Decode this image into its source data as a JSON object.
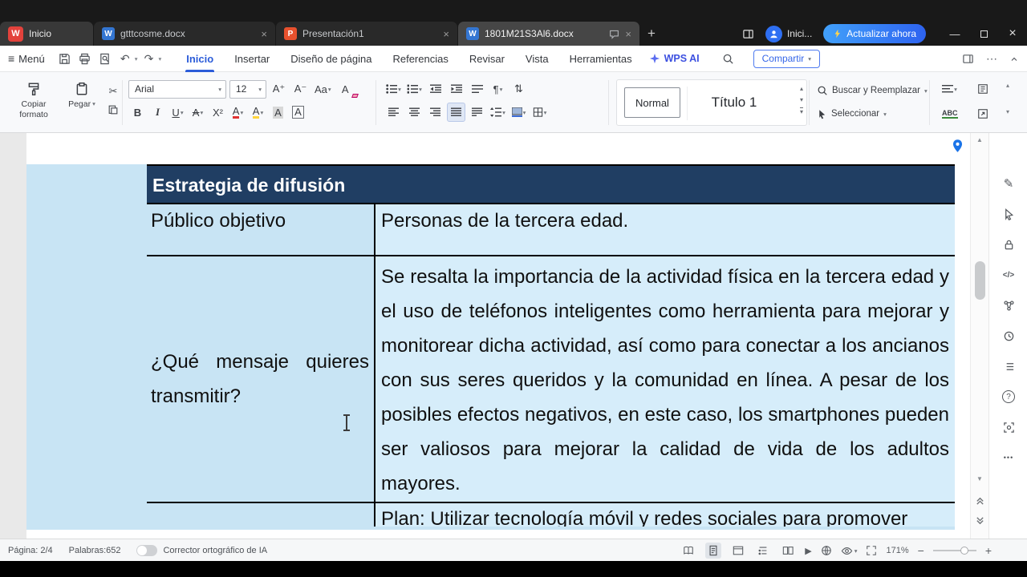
{
  "titlebar": {
    "home_tab_label": "Inicio",
    "tabs": [
      {
        "label": "gtttcosme.docx"
      },
      {
        "label": "Presentación1"
      },
      {
        "label": "1801M21S3Al6.docx"
      }
    ],
    "profile_label": "Inici...",
    "update_button_label": "Actualizar ahora"
  },
  "menubar": {
    "menu_label": "Menú",
    "items": [
      "Inicio",
      "Insertar",
      "Diseño de página",
      "Referencias",
      "Revisar",
      "Vista",
      "Herramientas"
    ],
    "active_item": "Inicio",
    "wps_ai_label": "WPS AI",
    "share_button_label": "Compartir"
  },
  "ribbon": {
    "copy_format_label": "Copiar formato",
    "paste_label": "Pegar",
    "font_name": "Arial",
    "font_size": "12",
    "style_normal_label": "Normal",
    "style_heading1_label": "Título 1",
    "find_replace_label": "Buscar y Reemplazar",
    "select_label": "Seleccionar"
  },
  "document": {
    "table_header": "Estrategia de difusión",
    "row1_label": "Público objetivo",
    "row1_content": "Personas de la tercera edad.",
    "row2_label": "¿Qué mensaje quieres transmitir?",
    "row2_content": "Se resalta la importancia de la actividad física en la tercera edad y el uso de teléfonos inteligentes como herramienta para mejorar y monitorear dicha actividad, así como para conectar a los ancianos con sus seres queridos y la comunidad en línea. A pesar de los posibles efectos negativos, en este caso, los smartphones pueden ser valiosos para mejorar la calidad de vida de los adultos mayores.",
    "row3_content": "Plan: Utilizar tecnología móvil y redes sociales para promover"
  },
  "statusbar": {
    "page_label": "Página: 2/4",
    "words_label": "Palabras:652",
    "spellcheck_label": "Corrector ortográfico de IA",
    "zoom_value": "171%"
  },
  "colors": {
    "accent_blue": "#2e6ff3",
    "active_menu_blue": "#2b5cd9",
    "table_header_bg": "#203e63",
    "cell_blue_left": "#c8e4f4",
    "cell_blue_right": "#d6edfa",
    "wps_red": "#e3423c",
    "word_blue": "#3476d2",
    "ppt_orange": "#e8512e"
  },
  "glyphs": {
    "hamburger": "≡",
    "caret_down": "▾",
    "caret_up": "▴",
    "plus": "+",
    "minus": "−",
    "window_minimize": "—",
    "window_close": "×",
    "tab_close": "×",
    "undo": "↶",
    "redo": "↷",
    "scissors": "✂",
    "pilcrow": "¶",
    "sort": "⇅",
    "more_h": "⋯",
    "play": "▶",
    "scroll_up": "▲",
    "scroll_down": "▼",
    "grow_font": "A⁺",
    "shrink_font": "A⁻",
    "change_case": "Aa",
    "bold": "B",
    "italic": "I",
    "underline": "U",
    "strike": "A",
    "superscript": "X²",
    "font_color": "A",
    "highlight": "A",
    "char_shading": "A",
    "char_border": "A",
    "clear_format": "A",
    "code": "</>",
    "help": "?",
    "pen": "✎",
    "more_dots": "•••",
    "abc": "ABC",
    "w_letter": "W",
    "p_letter": "P"
  }
}
